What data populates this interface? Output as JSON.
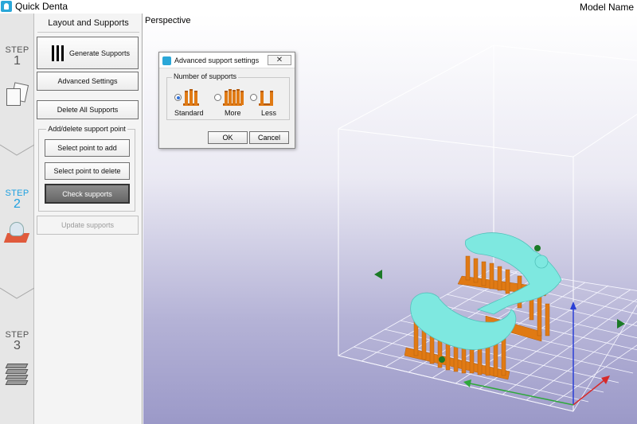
{
  "app": {
    "title": "Quick Denta",
    "model_name": "Model Name"
  },
  "steps": [
    {
      "word": "STEP",
      "number": "1",
      "active": false
    },
    {
      "word": "STEP",
      "number": "2",
      "active": true
    },
    {
      "word": "STEP",
      "number": "3",
      "active": false
    }
  ],
  "panel": {
    "title": "Layout and Supports",
    "generate_label": "Generate Supports",
    "advanced_label": "Advanced Settings",
    "delete_all_label": "Delete All Supports",
    "group_title": "Add/delete support point",
    "select_add_label": "Select point to add",
    "select_delete_label": "Select point to delete",
    "check_label": "Check supports",
    "update_label": "Update supports"
  },
  "viewport": {
    "label": "Perspective"
  },
  "dialog": {
    "title": "Advanced support settings",
    "close_glyph": "✕",
    "group_title": "Number of supports",
    "options": [
      {
        "label": "Standard",
        "selected": true
      },
      {
        "label": "More",
        "selected": false
      },
      {
        "label": "Less",
        "selected": false
      }
    ],
    "ok_label": "OK",
    "cancel_label": "Cancel"
  },
  "colors": {
    "accent": "#1ea0e0",
    "model": "#7ee8e0",
    "supports": "#e07a14",
    "grid": "#ffffff",
    "axis_z": "#2a3fd6",
    "axis_x": "#d62a2a",
    "axis_y": "#2ea83a"
  },
  "icons": [
    "app-logo-icon",
    "generate-supports-icon",
    "support-pillars-icon",
    "close-icon"
  ]
}
